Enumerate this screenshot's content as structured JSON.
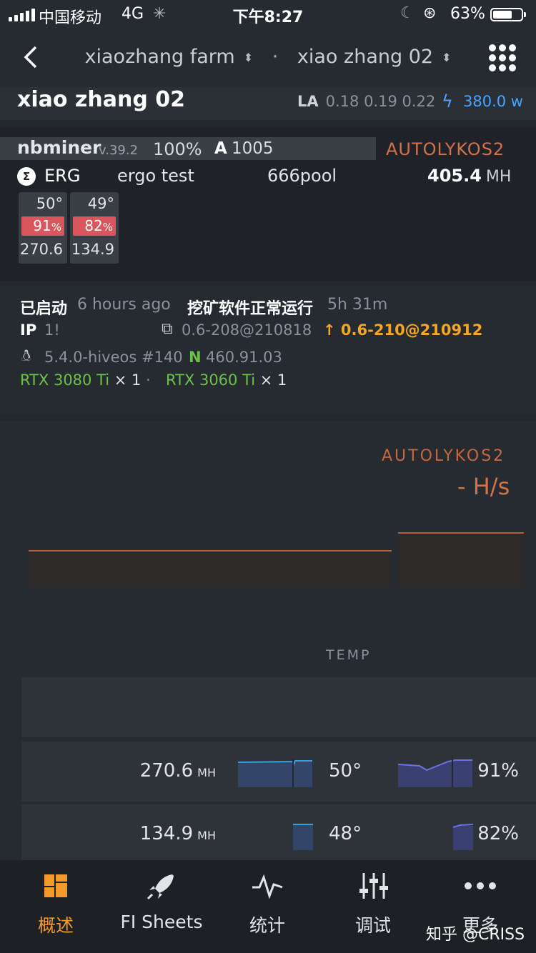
{
  "status": {
    "carrier": "中国移动",
    "network": "4G",
    "time": "下午8:27",
    "battery": "63%"
  },
  "nav": {
    "farm": "xiaozhang farm",
    "separator": "·",
    "rig": "xiao zhang 02"
  },
  "header": {
    "rig_name": "xiao zhang 02",
    "la_label": "LA",
    "la_values": "0.18 0.19 0.22",
    "power": "380.0 w"
  },
  "miner": {
    "name": "nbminer",
    "version": "v.39.2",
    "load": "100%",
    "accepted_label": "A",
    "accepted": "1005",
    "algo": "AUTOLYKOS2",
    "coin": "ERG",
    "wallet": "ergo test",
    "pool": "666pool",
    "hashrate": "405.4",
    "hash_unit": "MH",
    "gpus": [
      {
        "temp": "50°",
        "fan": "91",
        "fan_unit": "%",
        "hash": "270.6"
      },
      {
        "temp": "49°",
        "fan": "82",
        "fan_unit": "%",
        "hash": "134.9"
      }
    ]
  },
  "info": {
    "started_label": "已启动",
    "started_value": "6 hours ago",
    "running_label": "挖矿软件正常运行",
    "running_value": "5h 31m",
    "ip_label": "IP",
    "ip_value": "1!",
    "hive_version": "0.6-208@210818",
    "update_version": "0.6-210@210912",
    "kernel": "5.4.0-hiveos #140",
    "nvidia_label": "N",
    "nvidia_version": "460.91.03",
    "gpu1_model": "RTX 3080 Ti",
    "gpu1_count": "× 1",
    "dot": "·",
    "gpu2_model": "RTX 3060 Ti",
    "gpu2_count": "× 1"
  },
  "chart": {
    "algo": "AUTOLYKOS2",
    "value": "- H/s",
    "temp_label": "TEMP"
  },
  "temp_rows": [
    {
      "hash": "270.6",
      "unit": "MH",
      "temp": "50°",
      "fan": "91%"
    },
    {
      "hash": "134.9",
      "unit": "MH",
      "temp": "48°",
      "fan": "82%"
    }
  ],
  "tabs": [
    {
      "label": "概述",
      "icon": "dashboard-icon"
    },
    {
      "label": "FI Sheets",
      "icon": "rocket-icon"
    },
    {
      "label": "统计",
      "icon": "pulse-icon"
    },
    {
      "label": "调试",
      "icon": "sliders-icon"
    },
    {
      "label": "更多",
      "icon": "more-icon"
    }
  ],
  "watermark": "知乎 @CRISS",
  "colors": {
    "accent_orange": "#f39a2b",
    "algo": "#d0724a",
    "power_blue": "#4aa3ff",
    "nvidia_green": "#6fc04a",
    "fan_red": "#d8565c"
  }
}
